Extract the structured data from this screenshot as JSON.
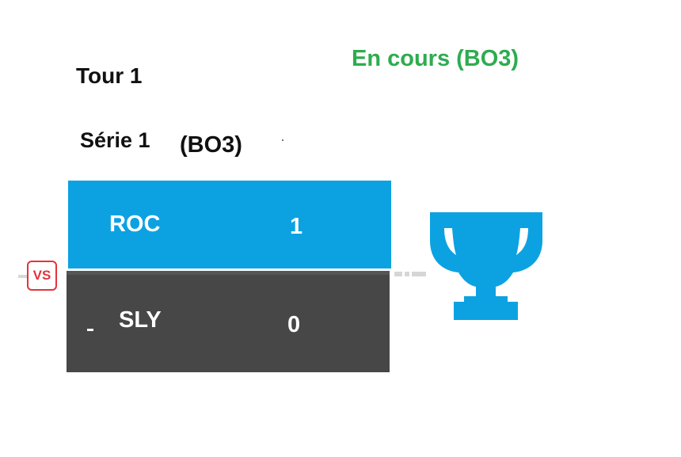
{
  "round": {
    "title": "Tour 1"
  },
  "status": {
    "label": "En cours (BO3)",
    "color": "#2eac4f"
  },
  "series": {
    "title": "Série 1",
    "format": "(BO3)"
  },
  "match": {
    "vs_label": "VS",
    "teams": [
      {
        "name": "ROC",
        "score": "1",
        "color": "#0ca2e2",
        "winner": true
      },
      {
        "name": "SLY",
        "score": "0",
        "color": "#474747",
        "winner": false
      }
    ]
  },
  "trophy": {
    "icon": "trophy-icon",
    "color": "#0ca2e2"
  }
}
